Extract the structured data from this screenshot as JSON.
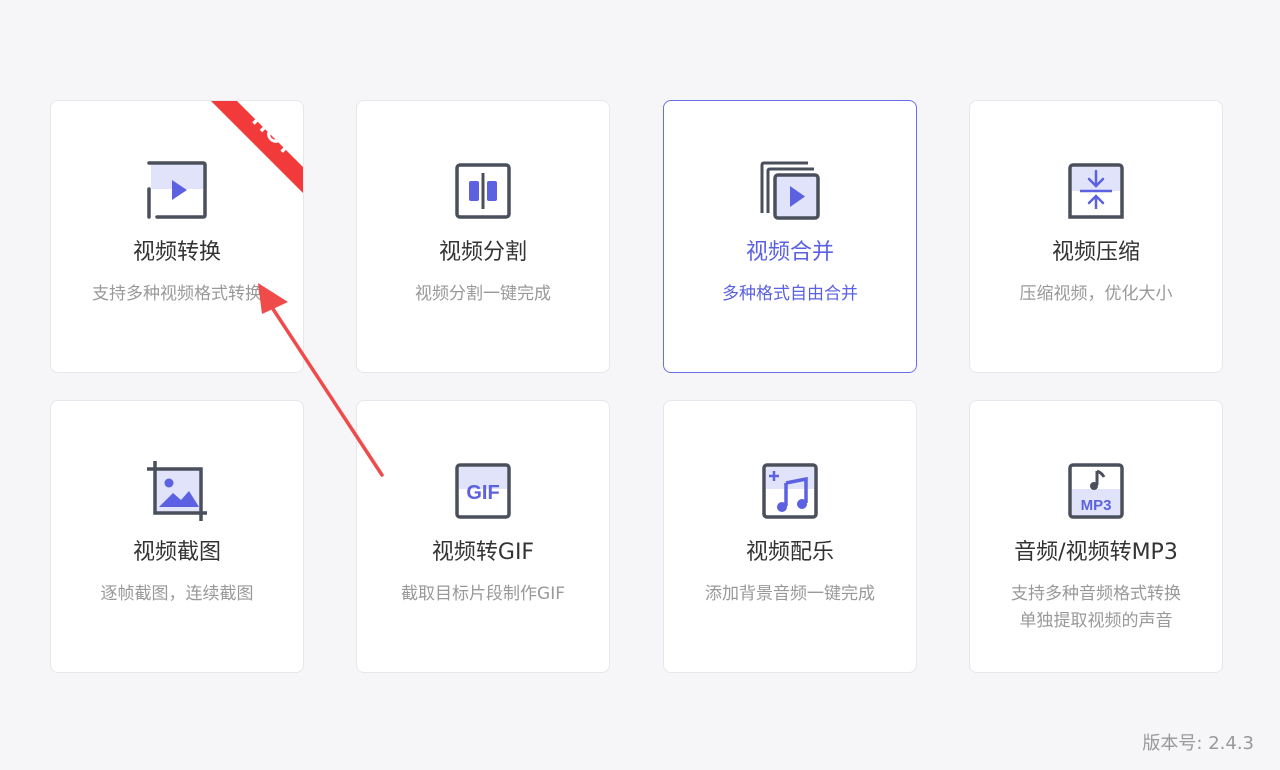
{
  "accent_color": "#5b61e0",
  "hot_color": "#f23a3a",
  "icon_color": "#4a4f5c",
  "icon_fill_color": "#e1e3fb",
  "cards": [
    {
      "title": "视频转换",
      "desc": [
        "支持多种视频格式转换"
      ],
      "icon": "video-convert-icon",
      "badge": "HOT"
    },
    {
      "title": "视频分割",
      "desc": [
        "视频分割一键完成"
      ],
      "icon": "video-split-icon"
    },
    {
      "title": "视频合并",
      "desc": [
        "多种格式自由合并"
      ],
      "icon": "video-merge-icon",
      "selected": true
    },
    {
      "title": "视频压缩",
      "desc": [
        "压缩视频，优化大小"
      ],
      "icon": "video-compress-icon"
    },
    {
      "title": "视频截图",
      "desc": [
        "逐帧截图，连续截图"
      ],
      "icon": "video-screenshot-icon"
    },
    {
      "title": "视频转GIF",
      "desc": [
        "截取目标片段制作GIF"
      ],
      "icon": "video-to-gif-icon",
      "icon_text": "GIF"
    },
    {
      "title": "视频配乐",
      "desc": [
        "添加背景音频一键完成"
      ],
      "icon": "video-music-icon"
    },
    {
      "title": "音频/视频转MP3",
      "desc": [
        "支持多种音频格式转换",
        "单独提取视频的声音"
      ],
      "icon": "to-mp3-icon",
      "icon_text": "MP3"
    }
  ],
  "version": "版本号: 2.4.3",
  "annotation": "red-arrow-pointing-to-video-convert"
}
